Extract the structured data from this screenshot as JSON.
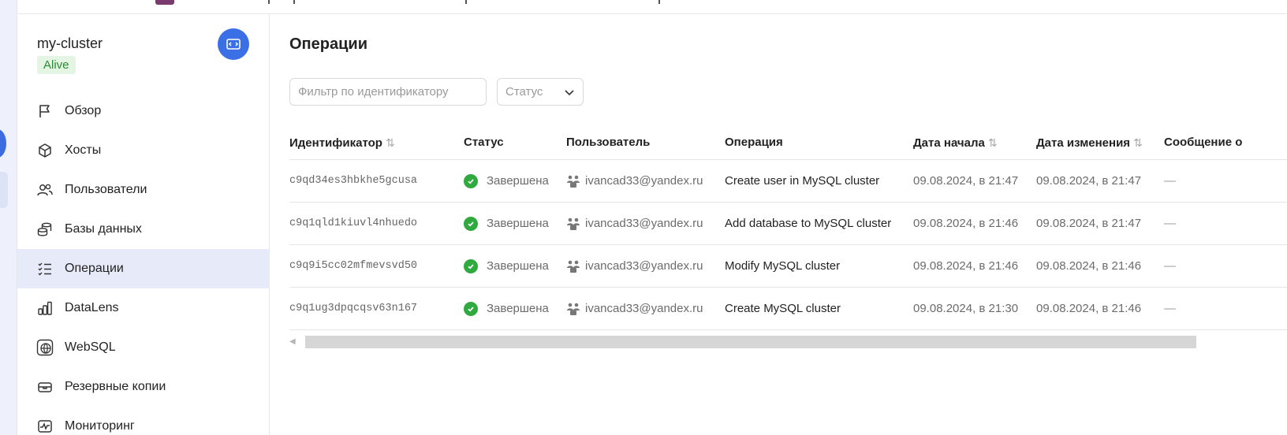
{
  "cluster": {
    "name": "my-cluster",
    "status": "Alive"
  },
  "sidebar": {
    "items": [
      {
        "label": "Обзор",
        "icon": "flag-icon",
        "active": false
      },
      {
        "label": "Хосты",
        "icon": "cube-icon",
        "active": false
      },
      {
        "label": "Пользователи",
        "icon": "users-icon",
        "active": false
      },
      {
        "label": "Базы данных",
        "icon": "databases-icon",
        "active": false
      },
      {
        "label": "Операции",
        "icon": "operations-list-icon",
        "active": true
      },
      {
        "label": "DataLens",
        "icon": "bar-chart-icon",
        "active": false
      },
      {
        "label": "WebSQL",
        "icon": "globe-icon",
        "active": false
      },
      {
        "label": "Резервные копии",
        "icon": "archive-icon",
        "active": false
      },
      {
        "label": "Мониторинг",
        "icon": "monitoring-icon",
        "active": false
      }
    ]
  },
  "main": {
    "title": "Операции",
    "filter_placeholder": "Фильтр по идентификатору",
    "status_select": "Статус"
  },
  "table": {
    "columns": [
      "Идентификатор",
      "Статус",
      "Пользователь",
      "Операция",
      "Дата начала",
      "Дата изменения",
      "Сообщение о"
    ],
    "rows": [
      {
        "id": "c9qd34es3hbkhe5gcusa",
        "status": "Завершена",
        "user": "ivancad33@yandex.ru",
        "operation": "Create user in MySQL cluster",
        "started": "09.08.2024, в 21:47",
        "modified": "09.08.2024, в 21:47",
        "message": "—"
      },
      {
        "id": "c9q1qld1kiuvl4nhuedo",
        "status": "Завершена",
        "user": "ivancad33@yandex.ru",
        "operation": "Add database to MySQL cluster",
        "started": "09.08.2024, в 21:46",
        "modified": "09.08.2024, в 21:47",
        "message": "—"
      },
      {
        "id": "c9q9i5cc02mfmevsvd50",
        "status": "Завершена",
        "user": "ivancad33@yandex.ru",
        "operation": "Modify MySQL cluster",
        "started": "09.08.2024, в 21:46",
        "modified": "09.08.2024, в 21:46",
        "message": "—"
      },
      {
        "id": "c9q1ug3dpqcqsv63n167",
        "status": "Завершена",
        "user": "ivancad33@yandex.ru",
        "operation": "Create MySQL cluster",
        "started": "09.08.2024, в 21:30",
        "modified": "09.08.2024, в 21:46",
        "message": "—"
      }
    ]
  },
  "colors": {
    "accent": "#3a6fe5",
    "success": "#30aa3f",
    "active_nav": "#e7ebf9",
    "badge_bg": "#e4f5e3",
    "badge_text": "#2d8a36"
  }
}
